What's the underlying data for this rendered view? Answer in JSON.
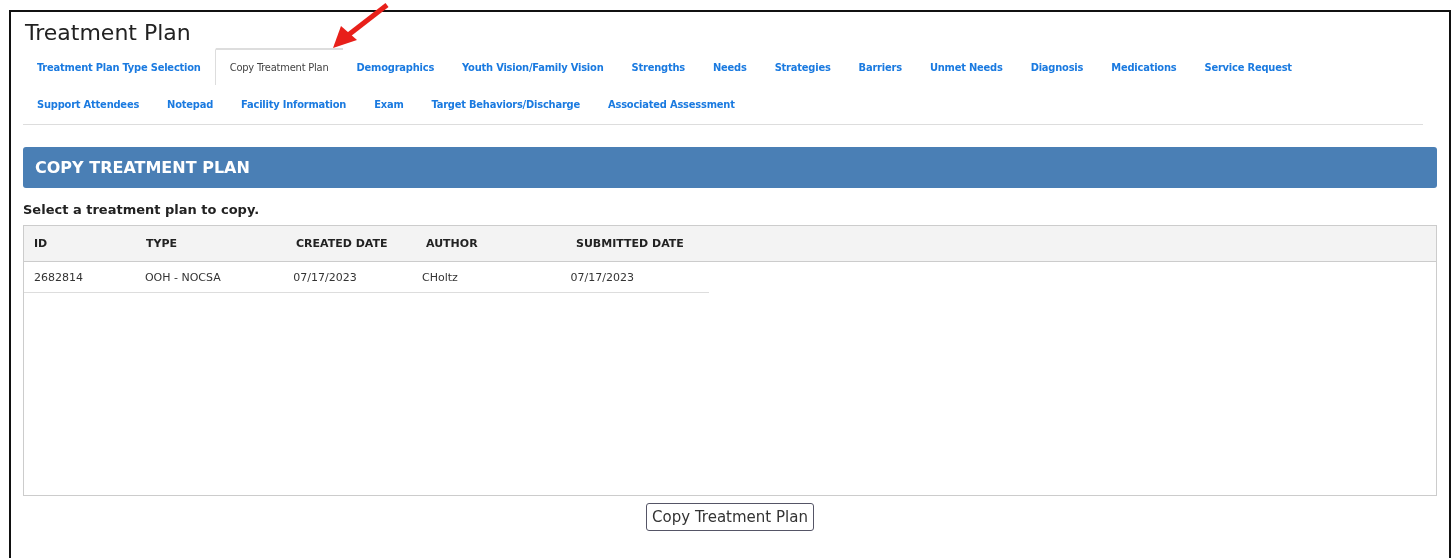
{
  "page": {
    "title": "Treatment Plan"
  },
  "tabs": [
    {
      "label": "Treatment Plan Type Selection",
      "selected": false
    },
    {
      "label": "Copy Treatment Plan",
      "selected": true
    },
    {
      "label": "Demographics",
      "selected": false
    },
    {
      "label": "Youth Vision/Family Vision",
      "selected": false
    },
    {
      "label": "Strengths",
      "selected": false
    },
    {
      "label": "Needs",
      "selected": false
    },
    {
      "label": "Strategies",
      "selected": false
    },
    {
      "label": "Barriers",
      "selected": false
    },
    {
      "label": "Unmet Needs",
      "selected": false
    },
    {
      "label": "Diagnosis",
      "selected": false
    },
    {
      "label": "Medications",
      "selected": false
    },
    {
      "label": "Service Request",
      "selected": false
    },
    {
      "label": "Support Attendees",
      "selected": false
    },
    {
      "label": "Notepad",
      "selected": false
    },
    {
      "label": "Facility Information",
      "selected": false
    },
    {
      "label": "Exam",
      "selected": false
    },
    {
      "label": "Target Behaviors/Discharge",
      "selected": false
    },
    {
      "label": "Associated Assessment",
      "selected": false
    }
  ],
  "panel": {
    "title": "COPY TREATMENT PLAN",
    "instruction": "Select a treatment plan to copy."
  },
  "table": {
    "columns": [
      "ID",
      "TYPE",
      "CREATED DATE",
      "AUTHOR",
      "SUBMITTED DATE"
    ],
    "rows": [
      [
        "2682814",
        "OOH - NOCSA",
        "07/17/2023",
        "CHoltz",
        "07/17/2023"
      ]
    ]
  },
  "button": {
    "label": "Copy Treatment Plan"
  }
}
